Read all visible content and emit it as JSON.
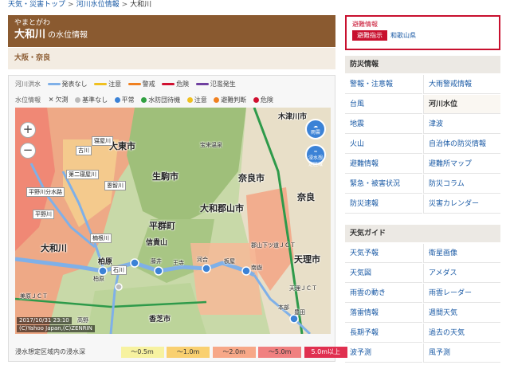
{
  "breadcrumb": {
    "items": [
      "天気・災害トップ",
      "河川水位情報"
    ],
    "separator": ">",
    "current": "大和川"
  },
  "title": {
    "reading": "やまとがわ",
    "name": "大和川",
    "suffix": "の水位情報"
  },
  "region": "大阪・奈良",
  "legend": {
    "flood_label": "河川洪水",
    "flood_items": [
      {
        "label": "発表なし",
        "color": "#7fb0e8"
      },
      {
        "label": "注意",
        "color": "#f0c020"
      },
      {
        "label": "警戒",
        "color": "#f08020"
      },
      {
        "label": "危険",
        "color": "#d01030"
      },
      {
        "label": "氾濫発生",
        "color": "#7040a0"
      }
    ],
    "level_label": "水位情報",
    "level_items": [
      {
        "label": "欠測",
        "symbol": "×",
        "color": "#555555"
      },
      {
        "label": "基準なし",
        "color": "#bbbbbb"
      },
      {
        "label": "平常",
        "color": "#3b82d6"
      },
      {
        "label": "水防団待機",
        "color": "#30a040"
      },
      {
        "label": "注意",
        "color": "#f0c020"
      },
      {
        "label": "避難判断",
        "color": "#f08020"
      },
      {
        "label": "危険",
        "color": "#d01030"
      }
    ]
  },
  "map": {
    "labels": [
      {
        "name": "label-daitoshi",
        "text": "大東市"
      },
      {
        "name": "label-ikoma",
        "text": "生駒市"
      },
      {
        "name": "label-nara",
        "text": "奈良"
      },
      {
        "name": "label-narashi",
        "text": "奈良市"
      },
      {
        "name": "label-yamatokoriyama",
        "text": "大和郡山市"
      },
      {
        "name": "label-heguri",
        "text": "平群町"
      },
      {
        "name": "label-shigisan",
        "text": "信貴山"
      },
      {
        "name": "label-kashiba",
        "text": "香芝市"
      },
      {
        "name": "label-tenri",
        "text": "天理市"
      },
      {
        "name": "label-kizugawa",
        "text": "木津川市"
      },
      {
        "name": "label-yamatogawa",
        "text": "大和川"
      },
      {
        "name": "label-hiranogawa",
        "text": "平野川"
      },
      {
        "name": "label-hiranogawabunsuiro",
        "text": "平野川分水路"
      },
      {
        "name": "label-neyagawa",
        "text": "寝屋川"
      },
      {
        "name": "label-kusuneji",
        "text": "楠根川"
      },
      {
        "name": "label-daini-neyagawa",
        "text": "第二寝屋川"
      },
      {
        "name": "label-onchigawa",
        "text": "恩智川"
      },
      {
        "name": "label-furukawa",
        "text": "古川"
      },
      {
        "name": "label-ishikawa",
        "text": "石川"
      },
      {
        "name": "label-kashiwara",
        "text": "柏原"
      },
      {
        "name": "label-koriyama-jct",
        "text": "郡山下ツ道ＪＣＴ"
      },
      {
        "name": "label-tenri-jct",
        "text": "天理ＪＣＴ"
      },
      {
        "name": "label-mihara-jct",
        "text": "美原ＪＣＴ"
      },
      {
        "name": "label-hokanji",
        "text": "宝来温泉"
      },
      {
        "name": "label-kobe",
        "text": "高野"
      },
      {
        "name": "label-honbu",
        "text": "本部"
      }
    ],
    "gauges": [
      {
        "name": "gauge-kashiwara",
        "text": "柏原"
      },
      {
        "name": "gauge-fujii",
        "text": "藤井"
      },
      {
        "name": "gauge-ojiin",
        "text": "王寺"
      },
      {
        "name": "gauge-kawai",
        "text": "河合"
      },
      {
        "name": "gauge-itado",
        "text": "板屋"
      },
      {
        "name": "gauge-minami",
        "text": "南嶽"
      },
      {
        "name": "gauge-toyoda",
        "text": "豊田"
      }
    ],
    "timestamp": "2017/10/31 23:10",
    "copyright": "(C)Yahoo Japan,(C)ZENRIN",
    "weather_buttons": [
      "雨雲",
      "浸水想定区域"
    ]
  },
  "depth": {
    "label": "浸水想定区域内の浸水深",
    "levels": [
      {
        "text": "～0.5m",
        "color": "#f7f2a0"
      },
      {
        "text": "～1.0m",
        "color": "#f9d070"
      },
      {
        "text": "～2.0m",
        "color": "#f7a888"
      },
      {
        "text": "～5.0m",
        "color": "#f08080"
      },
      {
        "text": "5.0m以上",
        "color": "#e03050"
      }
    ]
  },
  "alert": {
    "title": "避難情報",
    "badge": "避難指示",
    "prefecture": "和歌山県"
  },
  "bousai": {
    "title": "防災情報",
    "items": [
      "警報・注意報",
      "大雨警戒情報",
      "台風",
      "河川水位",
      "地震",
      "津波",
      "火山",
      "自治体の防災情報",
      "避難情報",
      "避難所マップ",
      "緊急・被害状況",
      "防災コラム",
      "防災速報",
      "災害カレンダー"
    ],
    "active": "河川水位"
  },
  "weather": {
    "title": "天気ガイド",
    "items": [
      "天気予報",
      "衛星画像",
      "天気図",
      "アメダス",
      "雨雲の動き",
      "雨雲レーダー",
      "落雷情報",
      "週間天気",
      "長期予報",
      "過去の天気",
      "波予測",
      "風予測"
    ]
  },
  "colors": {
    "brand": "#8a5a30",
    "link": "#1a5aa5",
    "alert": "#c8102e",
    "river_normal": "#7fb0e8"
  }
}
